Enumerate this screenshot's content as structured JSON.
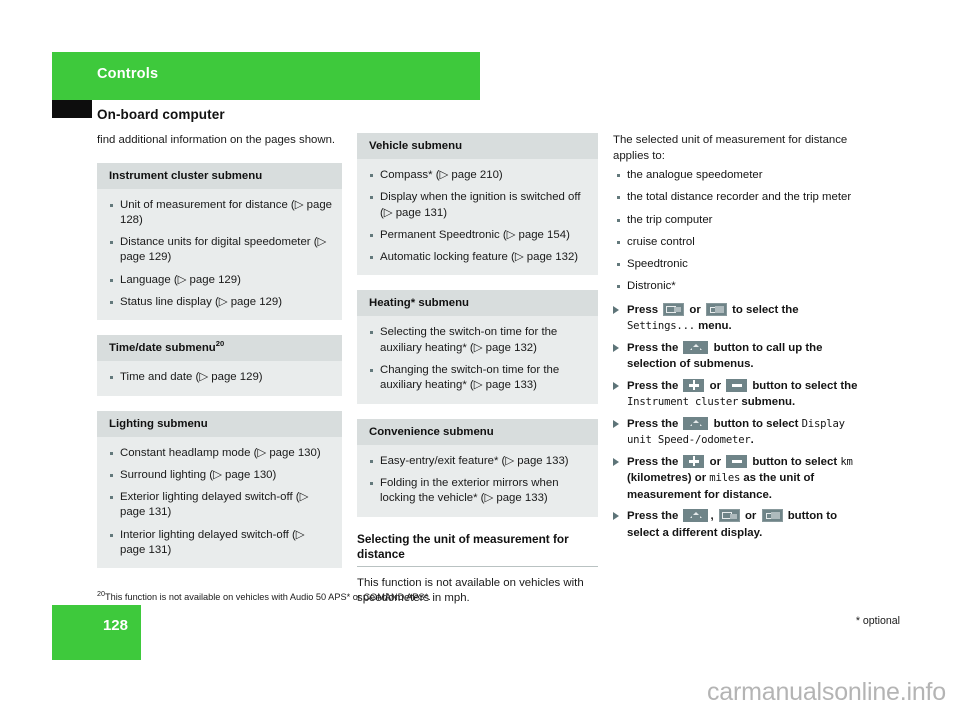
{
  "header": {
    "chapter_title": "Controls",
    "section_title": "On-board computer",
    "accent_color": "#3ec93c"
  },
  "left_column": {
    "intro": "find additional information on the pages shown.",
    "boxes": [
      {
        "title": "Instrument cluster submenu",
        "footnote_marker": "",
        "items": [
          "Unit of measurement for distance (▷ page 128)",
          "Distance units for digital speedometer (▷ page 129)",
          "Language (▷ page 129)",
          "Status line display (▷ page 129)"
        ]
      },
      {
        "title": "Time/date submenu",
        "footnote_marker": "20",
        "items": [
          "Time and date (▷ page 129)"
        ]
      },
      {
        "title": "Lighting submenu",
        "footnote_marker": "",
        "items": [
          "Constant headlamp mode (▷ page 130)",
          "Surround lighting (▷ page 130)",
          "Exterior lighting delayed switch-off (▷ page 131)",
          "Interior lighting delayed switch-off (▷ page 131)"
        ]
      }
    ]
  },
  "middle_column": {
    "boxes": [
      {
        "title": "Vehicle submenu",
        "footnote_marker": "",
        "items": [
          "Compass* (▷ page 210)",
          "Display when the ignition is switched off (▷ page 131)",
          "Permanent Speedtronic (▷ page 154)",
          "Automatic locking feature (▷ page 132)"
        ]
      },
      {
        "title": "Heating* submenu",
        "footnote_marker": "",
        "items": [
          "Selecting the switch-on time for the auxiliary heating* (▷ page 132)",
          "Changing the switch-on time for the auxiliary heating* (▷ page 133)"
        ]
      },
      {
        "title": "Convenience submenu",
        "footnote_marker": "",
        "items": [
          "Easy-entry/exit feature* (▷ page 133)",
          "Folding in the exterior mirrors when locking the vehicle* (▷ page 133)"
        ]
      }
    ],
    "sub_heading": "Selecting the unit of measurement for distance",
    "sub_paragraph": "This function is not available on vehicles with speedometers in mph."
  },
  "right_column": {
    "intro": "The selected unit of measurement for distance applies to:",
    "applies_to": [
      "the analogue speedometer",
      "the total distance recorder and the trip meter",
      "the trip computer",
      "cruise control",
      "Speedtronic",
      "Distronic*"
    ],
    "steps": [
      {
        "parts": [
          {
            "t": "text",
            "v": "Press "
          },
          {
            "t": "icon",
            "v": "display-button-icon"
          },
          {
            "t": "text",
            "v": " or "
          },
          {
            "t": "icon",
            "v": "display-button-icon-alt"
          },
          {
            "t": "text",
            "v": " to select the "
          },
          {
            "t": "mono",
            "v": "Settings..."
          },
          {
            "t": "text",
            "v": " menu."
          }
        ]
      },
      {
        "parts": [
          {
            "t": "text",
            "v": "Press the "
          },
          {
            "t": "icon",
            "v": "up-arrow-button-icon"
          },
          {
            "t": "text",
            "v": " button to call up the selection of submenus."
          }
        ]
      },
      {
        "parts": [
          {
            "t": "text",
            "v": "Press the "
          },
          {
            "t": "icon",
            "v": "plus-button-icon"
          },
          {
            "t": "text",
            "v": " or "
          },
          {
            "t": "icon",
            "v": "minus-button-icon"
          },
          {
            "t": "text",
            "v": " button to select the "
          },
          {
            "t": "mono",
            "v": "Instrument cluster"
          },
          {
            "t": "text",
            "v": " submenu."
          }
        ]
      },
      {
        "parts": [
          {
            "t": "text",
            "v": "Press the "
          },
          {
            "t": "icon",
            "v": "up-arrow-button-icon"
          },
          {
            "t": "text",
            "v": " button to select "
          },
          {
            "t": "mono",
            "v": "Display unit Speed-/odometer"
          },
          {
            "t": "text",
            "v": "."
          }
        ]
      },
      {
        "parts": [
          {
            "t": "text",
            "v": "Press the "
          },
          {
            "t": "icon",
            "v": "plus-button-icon"
          },
          {
            "t": "text",
            "v": " or "
          },
          {
            "t": "icon",
            "v": "minus-button-icon"
          },
          {
            "t": "text",
            "v": " button to select "
          },
          {
            "t": "mono",
            "v": "km"
          },
          {
            "t": "text",
            "v": " (kilometres) or "
          },
          {
            "t": "mono",
            "v": "miles"
          },
          {
            "t": "text",
            "v": " as the unit of measurement for distance."
          }
        ]
      },
      {
        "parts": [
          {
            "t": "text",
            "v": "Press the "
          },
          {
            "t": "icon",
            "v": "up-arrow-button-icon"
          },
          {
            "t": "text",
            "v": ", "
          },
          {
            "t": "icon",
            "v": "display-button-icon"
          },
          {
            "t": "text",
            "v": " or "
          },
          {
            "t": "icon",
            "v": "display-button-icon-alt"
          },
          {
            "t": "text",
            "v": " button to select a different display."
          }
        ]
      }
    ]
  },
  "footer": {
    "footnote_marker": "20",
    "footnote_text": "This function is not available on vehicles with Audio 50 APS* or COMAND APS*.",
    "page_number": "128",
    "optional_note": "* optional",
    "watermark": "carmanualsonline.info"
  }
}
